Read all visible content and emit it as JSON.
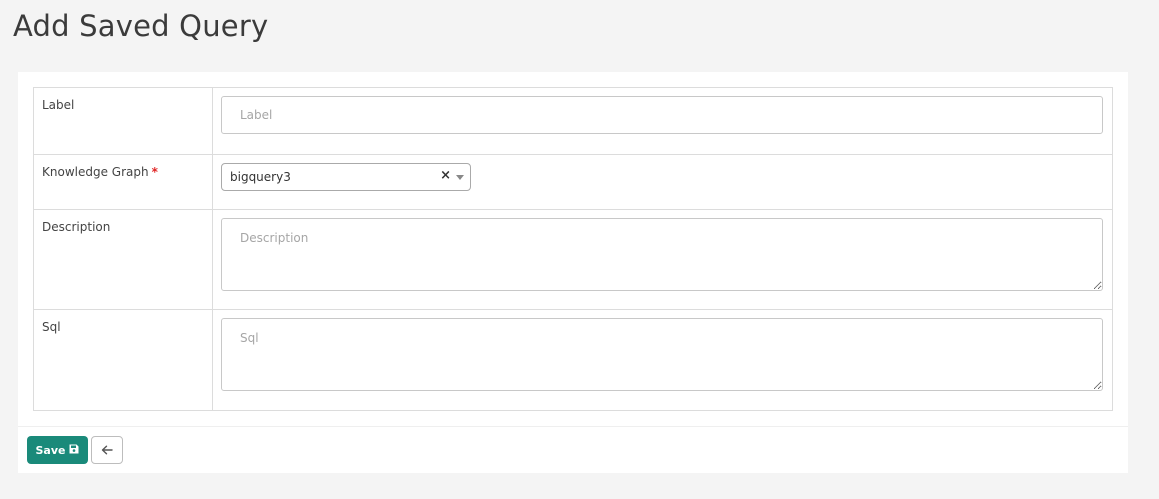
{
  "page": {
    "title": "Add Saved Query"
  },
  "form": {
    "label": {
      "label": "Label",
      "placeholder": "Label",
      "value": ""
    },
    "knowledge_graph": {
      "label": "Knowledge Graph",
      "required_marker": "*",
      "selected": "bigquery3",
      "clear_glyph": "×"
    },
    "description": {
      "label": "Description",
      "placeholder": "Description",
      "value": ""
    },
    "sql": {
      "label": "Sql",
      "placeholder": "Sql",
      "value": ""
    }
  },
  "actions": {
    "save_label": "Save",
    "save_icon": "floppy-disk-icon",
    "back_icon": "arrow-left-icon"
  },
  "colors": {
    "accent": "#1a8a7a",
    "required": "#e02424",
    "background": "#f4f4f4"
  }
}
